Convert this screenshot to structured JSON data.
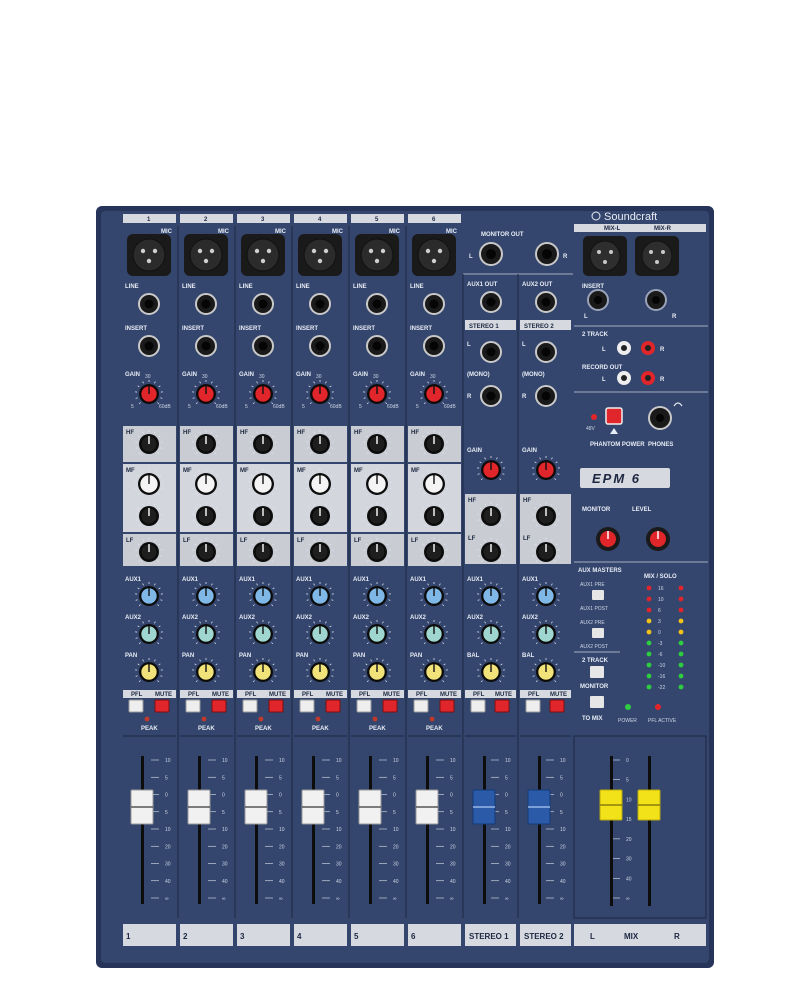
{
  "brand": "Soundcraft",
  "model": "EPM 6",
  "colors": {
    "panel": "#34466e",
    "panel_dark": "#26345a",
    "eq_light": "#c9ccd3",
    "gain_knob": "#e0262b",
    "aux_knob": "#7fb8e6",
    "aux2_knob": "#9fd6cf",
    "pan_knob": "#f2e27a",
    "mute_red": "#e0262b",
    "fader_white": "#f1f1f1",
    "fader_blue": "#2a5aa8",
    "fader_yellow": "#f2e21a"
  },
  "channels": [
    {
      "number": "1",
      "strip": "1"
    },
    {
      "number": "2",
      "strip": "2"
    },
    {
      "number": "3",
      "strip": "3"
    },
    {
      "number": "4",
      "strip": "4"
    },
    {
      "number": "5",
      "strip": "5"
    },
    {
      "number": "6",
      "strip": "6"
    }
  ],
  "labels": {
    "mic": "MIC",
    "line": "LINE",
    "insert": "INSERT",
    "gain": "GAIN",
    "gain_min": "5",
    "gain_mid": "30",
    "gain_max": "60dB",
    "hf": "HF",
    "mf": "MF",
    "lf": "LF",
    "aux1": "AUX1",
    "aux2": "AUX2",
    "pan": "PAN",
    "bal": "BAL",
    "pfl": "PFL",
    "mute": "MUTE",
    "peak": "PEAK",
    "monitor_out": "MONITOR OUT",
    "aux1_out": "AUX1 OUT",
    "aux2_out": "AUX2 OUT",
    "stereo1": "STEREO 1",
    "stereo2": "STEREO 2",
    "left": "L",
    "mono": "(MONO)",
    "right": "R",
    "mix_l": "MIX-L",
    "mix_r": "MIX-R",
    "two_track": "2 TRACK",
    "record_out": "RECORD OUT",
    "v48": "48V",
    "phantom_power": "PHANTOM POWER",
    "phones": "PHONES",
    "monitor": "MONITOR",
    "level": "LEVEL",
    "aux_masters": "AUX MASTERS",
    "aux1_pre": "AUX1 PRE",
    "aux1_post": "AUX1 POST",
    "aux2_pre": "AUX2 PRE",
    "aux2_post": "AUX2 POST",
    "to_mix": "TO MIX",
    "power": "POWER",
    "pfl_active": "PFL ACTIVE",
    "mix_solo": "MIX / SOLO",
    "mix": "MIX"
  },
  "stereo_strips": [
    {
      "strip": "STEREO 1"
    },
    {
      "strip": "STEREO 2"
    }
  ],
  "master_strip": {
    "left": "L",
    "center": "MIX",
    "right": "R"
  },
  "fader_scale": [
    "10",
    "5",
    "0",
    "5",
    "10",
    "20",
    "30",
    "40",
    "∞"
  ],
  "master_fader_scale": [
    "0",
    "5",
    "10",
    "15",
    "20",
    "30",
    "40",
    "∞"
  ],
  "meter_labels": [
    "16",
    "10",
    "6",
    "3",
    "0",
    "-3",
    "-6",
    "-10",
    "-16",
    "-22"
  ]
}
